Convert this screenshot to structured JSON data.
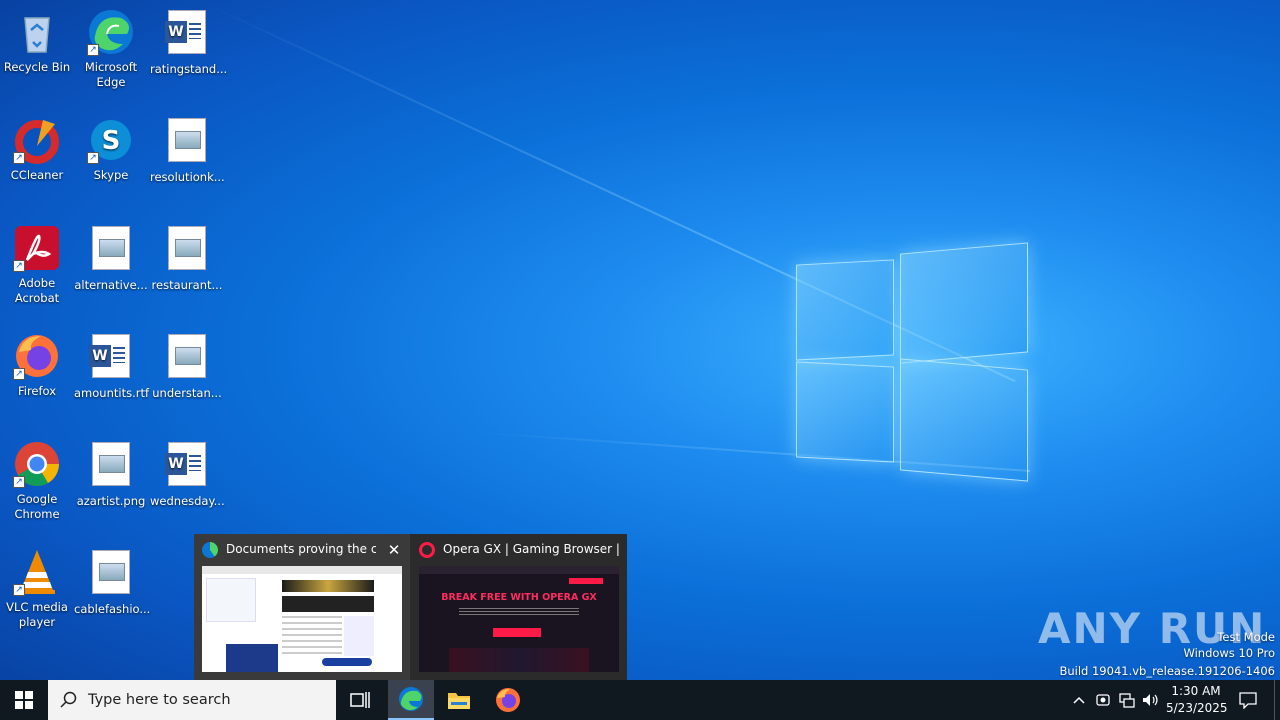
{
  "desktop": {
    "icons": [
      {
        "label": "Recycle Bin",
        "icon": "recycle-bin-icon"
      },
      {
        "label": "Microsoft Edge",
        "icon": "edge-icon"
      },
      {
        "label": "ratingstand...",
        "icon": "word-doc-icon"
      },
      {
        "label": "CCleaner",
        "icon": "ccleaner-icon"
      },
      {
        "label": "Skype",
        "icon": "skype-icon"
      },
      {
        "label": "resolutionk...",
        "icon": "image-file-icon"
      },
      {
        "label": "Adobe Acrobat",
        "icon": "acrobat-icon"
      },
      {
        "label": "alternative...",
        "icon": "image-file-icon"
      },
      {
        "label": "restaurant...",
        "icon": "image-file-icon"
      },
      {
        "label": "Firefox",
        "icon": "firefox-icon"
      },
      {
        "label": "amountits.rtf",
        "icon": "word-doc-icon"
      },
      {
        "label": "understan...",
        "icon": "image-file-icon"
      },
      {
        "label": "Google Chrome",
        "icon": "chrome-icon"
      },
      {
        "label": "azartist.png",
        "icon": "image-file-icon"
      },
      {
        "label": "wednesday...",
        "icon": "word-doc-icon"
      },
      {
        "label": "VLC media player",
        "icon": "vlc-icon"
      },
      {
        "label": "cablefashio...",
        "icon": "image-file-icon"
      }
    ]
  },
  "thumbnails": [
    {
      "title": "Documents proving the c...",
      "close": "✕",
      "preview_heading": ""
    },
    {
      "title": "Opera GX | Gaming Browser | O...",
      "preview_heading": "BREAK FREE WITH OPERA GX"
    }
  ],
  "watermark": {
    "logo": "ANY RUN",
    "mode": "Test Mode",
    "edition": "Windows 10 Pro",
    "build": "Build 19041.vb_release.191206-1406"
  },
  "taskbar": {
    "search_placeholder": "Type here to search",
    "time": "1:30 AM",
    "date": "5/23/2025"
  },
  "colors": {
    "taskbar": "#101820",
    "edge_blue": "#0a78d4",
    "opera_red": "#ff1b48"
  }
}
